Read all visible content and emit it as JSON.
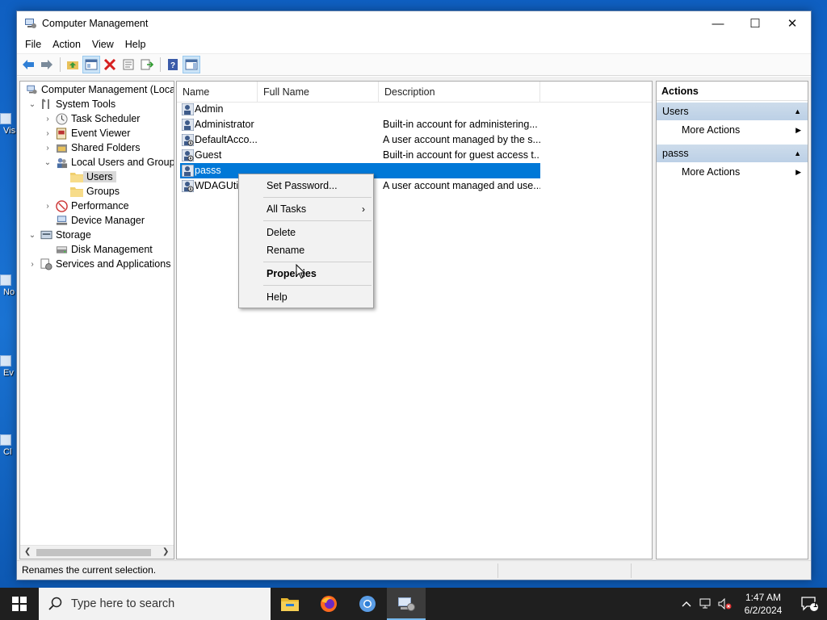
{
  "window": {
    "title": "Computer Management",
    "minimize": "—",
    "maximize": "☐",
    "close": "✕"
  },
  "menu": [
    "File",
    "Action",
    "View",
    "Help"
  ],
  "tree": [
    {
      "label": "Computer Management (Local",
      "expander": "",
      "icon": "computer-management-icon"
    },
    {
      "label": "System Tools",
      "expander": "⌄",
      "icon": "tools-icon"
    },
    {
      "label": "Task Scheduler",
      "expander": "›",
      "icon": "clock-icon"
    },
    {
      "label": "Event Viewer",
      "expander": "›",
      "icon": "event-viewer-icon"
    },
    {
      "label": "Shared Folders",
      "expander": "›",
      "icon": "shared-folder-icon"
    },
    {
      "label": "Local Users and Groups",
      "expander": "⌄",
      "icon": "users-groups-icon"
    },
    {
      "label": "Users",
      "expander": "",
      "icon": "folder-icon"
    },
    {
      "label": "Groups",
      "expander": "",
      "icon": "folder-icon"
    },
    {
      "label": "Performance",
      "expander": "›",
      "icon": "performance-icon"
    },
    {
      "label": "Device Manager",
      "expander": "",
      "icon": "device-manager-icon"
    },
    {
      "label": "Storage",
      "expander": "⌄",
      "icon": "storage-icon"
    },
    {
      "label": "Disk Management",
      "expander": "",
      "icon": "disk-icon"
    },
    {
      "label": "Services and Applications",
      "expander": "›",
      "icon": "services-icon"
    }
  ],
  "list": {
    "columns": [
      "Name",
      "Full Name",
      "Description"
    ],
    "rows": [
      {
        "name": "Admin",
        "full_name": "",
        "description": ""
      },
      {
        "name": "Administrator",
        "full_name": "",
        "description": "Built-in account for administering..."
      },
      {
        "name": "DefaultAcco...",
        "full_name": "",
        "description": "A user account managed by the s..."
      },
      {
        "name": "Guest",
        "full_name": "",
        "description": "Built-in account for guest access t..."
      },
      {
        "name": "passs",
        "full_name": "",
        "description": ""
      },
      {
        "name": "WDAGUtil",
        "full_name": "",
        "description": "A user account managed and use..."
      }
    ]
  },
  "actions": {
    "title": "Actions",
    "sections": [
      {
        "label": "Users",
        "item": "More Actions"
      },
      {
        "label": "passs",
        "item": "More Actions"
      }
    ]
  },
  "context_menu": {
    "items": [
      "Set Password...",
      "All Tasks",
      "Delete",
      "Rename",
      "Properties",
      "Help"
    ],
    "all_tasks_arrow": "›"
  },
  "status": {
    "text": "Renames the current selection."
  },
  "desktop_icons": [
    "Vis",
    "No",
    "Ev",
    "Cl"
  ],
  "taskbar": {
    "search_placeholder": "Type here to search",
    "time": "1:47 AM",
    "date": "6/2/2024",
    "notification_count": "1"
  },
  "colors": {
    "selection": "#0078d7",
    "taskbar": "#1f1f1f",
    "desktop": "#1769c4"
  }
}
